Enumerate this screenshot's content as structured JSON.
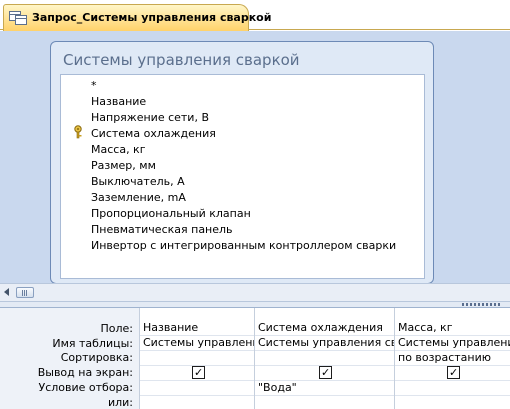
{
  "tab": {
    "title": "Запрос_Системы управления сваркой",
    "icon": "query-icon"
  },
  "fieldlist": {
    "title": "Системы управления сваркой",
    "fields": [
      "*",
      "Название",
      "Напряжение сети, В",
      "Система охлаждения",
      "Масса, кг",
      "Размер, мм",
      "Выключатель, А",
      "Заземление, mA",
      "Пропорциональный клапан",
      "Пневматическая панель",
      "Инвертор с интегрированным контроллером сварки"
    ],
    "key_field_index": 1
  },
  "grid": {
    "row_labels": [
      "Поле:",
      "Имя таблицы:",
      "Сортировка:",
      "Вывод на экран:",
      "Условие отбора:",
      "или:"
    ],
    "columns": [
      {
        "field": "Название",
        "table": "Системы управления",
        "sort": "",
        "show": true,
        "criteria": "",
        "or": ""
      },
      {
        "field": "Система охлаждения",
        "table": "Системы управления свар",
        "sort": "",
        "show": true,
        "criteria": "\"Вода\"",
        "or": ""
      },
      {
        "field": "Масса, кг",
        "table": "Системы управления",
        "sort": "по возрастанию",
        "show": true,
        "criteria": "",
        "or": ""
      }
    ]
  },
  "colors": {
    "design_bg": "#c9d8ee",
    "tab_bg": "#ffd26a",
    "border": "#6d8ab6"
  }
}
